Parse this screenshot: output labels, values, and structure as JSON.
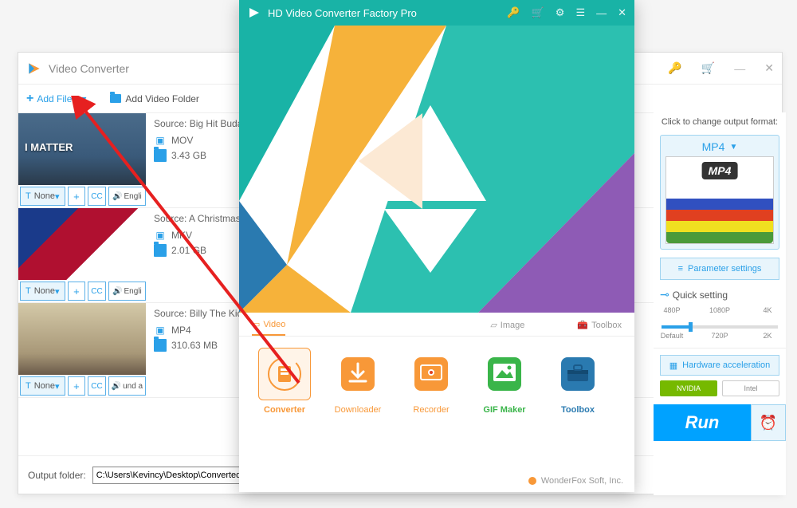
{
  "back": {
    "title": "Video Converter",
    "toolbar": {
      "add_files": "Add Files",
      "add_folder": "Add Video Folder"
    },
    "items": [
      {
        "source": "Source: Big Hit Buda- I",
        "format": "MOV",
        "size": "3.43 GB",
        "thumb_text": "I MATTER",
        "track": "None",
        "audio": "Engli"
      },
      {
        "source": "Source: A Christmas N",
        "format": "MKV",
        "size": "2.01 GB",
        "thumb_text": "",
        "track": "None",
        "audio": "Engli"
      },
      {
        "source": "Source: Billy The Kid_...",
        "format": "MP4",
        "size": "310.63 MB",
        "thumb_text": "",
        "track": "None",
        "audio": "und a"
      }
    ],
    "footer": {
      "label": "Output folder:",
      "path": "C:\\Users\\Kevincy\\Desktop\\Converted File"
    }
  },
  "right": {
    "title": "Click to change output format:",
    "format": "MP4",
    "format_badge": "MP4",
    "param": "Parameter settings",
    "quick": "Quick setting",
    "res_top": [
      "480P",
      "1080P",
      "4K"
    ],
    "res_bottom": [
      "Default",
      "720P",
      "2K"
    ],
    "hw": "Hardware acceleration",
    "badges": [
      "NVIDIA",
      "Intel"
    ],
    "run": "Run"
  },
  "front": {
    "title": "HD Video Converter Factory Pro",
    "tabs": {
      "video": "Video",
      "image": "Image",
      "toolbox": "Toolbox"
    },
    "tiles": {
      "converter": "Converter",
      "downloader": "Downloader",
      "recorder": "Recorder",
      "gifmaker": "GIF Maker",
      "toolbox": "Toolbox"
    },
    "footer": "WonderFox Soft, Inc."
  }
}
